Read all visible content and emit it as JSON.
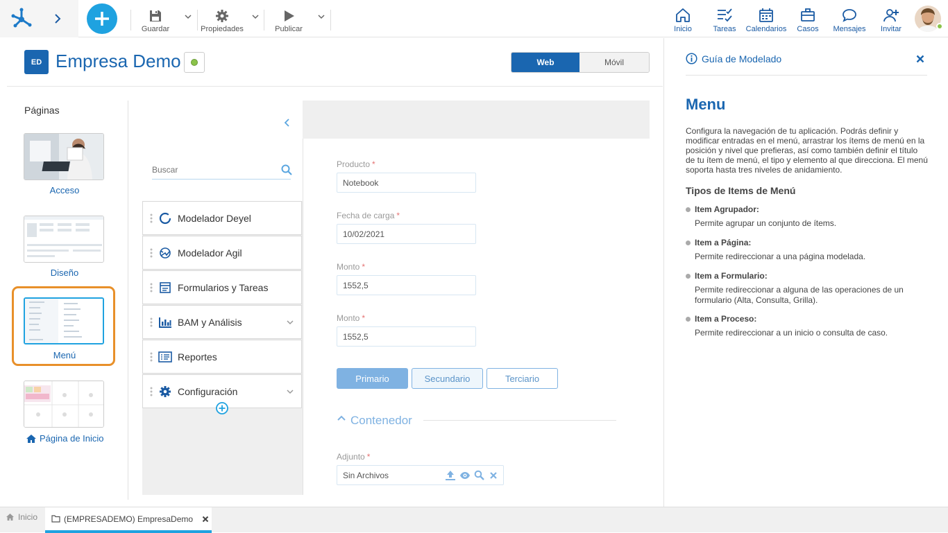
{
  "toolbar": {
    "save_label": "Guardar",
    "properties_label": "Propiedades",
    "publish_label": "Publicar"
  },
  "nav": {
    "inicio": "Inicio",
    "tareas": "Tareas",
    "calendarios": "Calendarios",
    "casos": "Casos",
    "mensajes": "Mensajes",
    "invitar": "Invitar"
  },
  "app": {
    "badge": "ED",
    "title": "Empresa Demo",
    "status_color": "#8bc34a",
    "view_toggle": {
      "web": "Web",
      "mobile": "Móvil",
      "selected": "Web"
    }
  },
  "pages": {
    "heading": "Páginas",
    "items": [
      {
        "label": "Acceso"
      },
      {
        "label": "Diseño"
      },
      {
        "label": "Menú",
        "selected": true
      },
      {
        "label": "Página de Inicio"
      }
    ]
  },
  "menu_panel": {
    "search_placeholder": "Buscar",
    "items": [
      {
        "label": "Modelador Deyel",
        "icon": "deyel-ring-icon",
        "expandable": false
      },
      {
        "label": "Modelador Agil",
        "icon": "agile-icon",
        "expandable": false
      },
      {
        "label": "Formularios y Tareas",
        "icon": "forms-icon",
        "expandable": false
      },
      {
        "label": "BAM y Análisis",
        "icon": "bar-chart-icon",
        "expandable": true
      },
      {
        "label": "Reportes",
        "icon": "reports-icon",
        "expandable": false
      },
      {
        "label": "Configuración",
        "icon": "gear-icon",
        "expandable": true
      }
    ]
  },
  "form": {
    "fields": [
      {
        "label": "Producto",
        "value": "Notebook",
        "required": true
      },
      {
        "label": "Fecha de carga",
        "value": "10/02/2021",
        "required": true
      },
      {
        "label": "Monto",
        "value": "1552,5",
        "required": true
      },
      {
        "label": "Monto",
        "value": "1552,5",
        "required": true
      }
    ],
    "buttons": {
      "primary": "Primario",
      "secondary": "Secundario",
      "tertiary": "Terciario"
    },
    "container_label": "Contenedor",
    "attachment": {
      "label": "Adjunto",
      "value": "Sin Archivos",
      "required": true
    }
  },
  "guide": {
    "header": "Guía de Modelado",
    "title": "Menu",
    "intro": "Configura la navegación de tu aplicación. Podrás definir y modificar entradas en el menú, arrastrar los ítems de menú en la posición y nivel que prefieras, así como también definir el título de tu ítem de menú, el tipo y elemento al que direcciona. El menú soporta hasta tres niveles de anidamiento.",
    "subtitle": "Tipos de Items de Menú",
    "items": [
      {
        "title": "Item Agrupador:",
        "desc": "Permite agrupar un conjunto de ítems."
      },
      {
        "title": "Item a Página:",
        "desc": "Permite redireccionar a una página modelada."
      },
      {
        "title": "Item a Formulario:",
        "desc": "Permite redireccionar a alguna de las operaciones de un formulario (Alta, Consulta, Grilla)."
      },
      {
        "title": "Item a Proceso:",
        "desc": "Permite redireccionar a un inicio o consulta de caso."
      }
    ]
  },
  "tabs": {
    "home": "Inicio",
    "current": "(EMPRESADEMO) EmpresaDemo"
  },
  "colors": {
    "brand": "#1a66b0",
    "accent": "#1fa2e0",
    "selected_border": "#e8902a",
    "primary_button": "#7fb2e2"
  }
}
